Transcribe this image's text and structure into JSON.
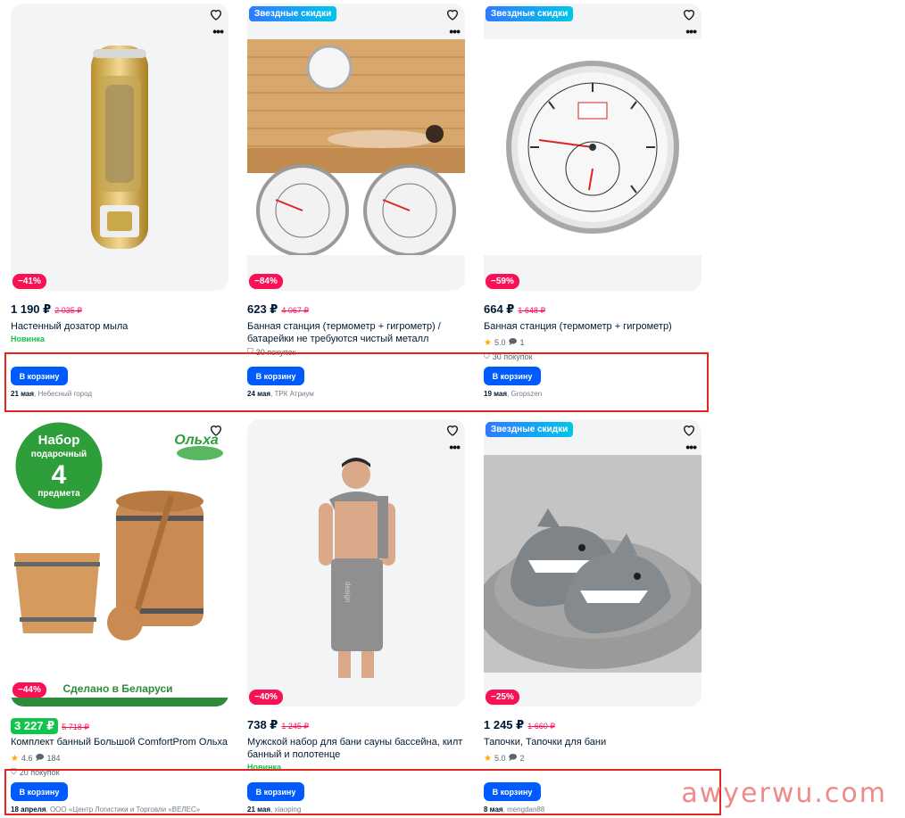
{
  "products": [
    {
      "promo": "",
      "discount": "−41%",
      "price": "1 190 ₽",
      "old_price": "2 035 ₽",
      "title": "Настенный дозатор мыла",
      "badge": "Новинка",
      "rating": "",
      "reviews": "",
      "sold": "",
      "cart_label": "В корзину",
      "delivery_date": "21 мая",
      "seller": "Небесный город"
    },
    {
      "promo": "Звездные скидки",
      "discount": "−84%",
      "price": "623 ₽",
      "old_price": "4 067 ₽",
      "title": "Банная станция (термометр + гигрометр) / батарейки не требуются чистый металл",
      "badge": "",
      "rating": "",
      "reviews": "",
      "sold": "30 покупок",
      "cart_label": "В корзину",
      "delivery_date": "24 мая",
      "seller": "ТРК Атриум"
    },
    {
      "promo": "Звездные скидки",
      "discount": "−59%",
      "price": "664 ₽",
      "old_price": "1 648 ₽",
      "title": "Банная станция (термометр + гигрометр)",
      "badge": "",
      "rating": "5.0",
      "reviews": "1",
      "sold": "30 покупок",
      "cart_label": "В корзину",
      "delivery_date": "19 мая",
      "seller": "Gropszen"
    },
    {
      "promo": "",
      "discount": "−44%",
      "price": "3 227 ₽",
      "old_price": "5 718 ₽",
      "title": "Комплект банный Большой ComfortProm Ольха",
      "badge": "",
      "rating": "4.6",
      "reviews": "184",
      "sold": "20 покупок",
      "cart_label": "В корзину",
      "delivery_date": "18 апреля",
      "seller": "ООО «Центр Логистики и Торговли «ВЕЛЕС»"
    },
    {
      "promo": "",
      "discount": "−40%",
      "price": "738 ₽",
      "old_price": "1 245 ₽",
      "title": "Мужской набор для бани сауны бассейна, килт банный и полотенце",
      "badge": "Новинка",
      "rating": "",
      "reviews": "",
      "sold": "",
      "cart_label": "В корзину",
      "delivery_date": "21 мая",
      "seller": "xiaoping"
    },
    {
      "promo": "Звездные скидки",
      "discount": "−25%",
      "price": "1 245 ₽",
      "old_price": "1 660 ₽",
      "title": "Тапочки, Тапочки для бани",
      "badge": "",
      "rating": "5.0",
      "reviews": "2",
      "sold": "",
      "cart_label": "В корзину",
      "delivery_date": "8 мая",
      "seller": "mengdan88"
    }
  ],
  "image_text": {
    "set_badge_line1": "Набор",
    "set_badge_line2": "подарочный",
    "set_badge_number": "4",
    "set_badge_line3": "предмета",
    "brand_olha": "Ольха",
    "made_in": "Сделано в Беларуси",
    "kilt_print": "design"
  },
  "watermark": "awyerwu.com",
  "colors": {
    "accent": "#005bff",
    "discount": "#f91155",
    "new": "#10c44c",
    "highlight_frame": "#e52521"
  }
}
